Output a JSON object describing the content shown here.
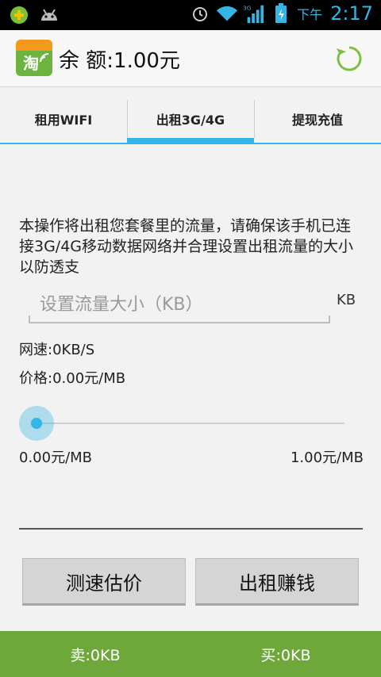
{
  "status_bar": {
    "ampm": "下午",
    "time": "2:17",
    "network": "3G"
  },
  "header": {
    "logo_char": "淘",
    "balance_label": "余 额:",
    "balance_value": "1.00元"
  },
  "tabs": [
    {
      "label": "租用WIFI",
      "active": false
    },
    {
      "label": "出租3G/4G",
      "active": true
    },
    {
      "label": "提现充值",
      "active": false
    }
  ],
  "main": {
    "description": "本操作将出租您套餐里的流量，请确保该手机已连接3G/4G移动数据网络并合理设置出租流量的大小以防透支",
    "traffic_input": {
      "value": "",
      "placeholder": "设置流量大小（KB）"
    },
    "traffic_unit": "KB",
    "speed_text": "网速:0KB/S",
    "price_text": "价格:0.00元/MB",
    "slider": {
      "value": 0,
      "min_label": "0.00元/MB",
      "max_label": "1.00元/MB"
    },
    "estimate_button": "测速估价",
    "rent_button": "出租赚钱"
  },
  "bottom_bar": {
    "sell": "卖:0KB",
    "buy": "买:0KB"
  },
  "colors": {
    "accent": "#33b5e5",
    "bottom_bar": "#6fa83a",
    "refresh_icon": "#7cc142"
  }
}
